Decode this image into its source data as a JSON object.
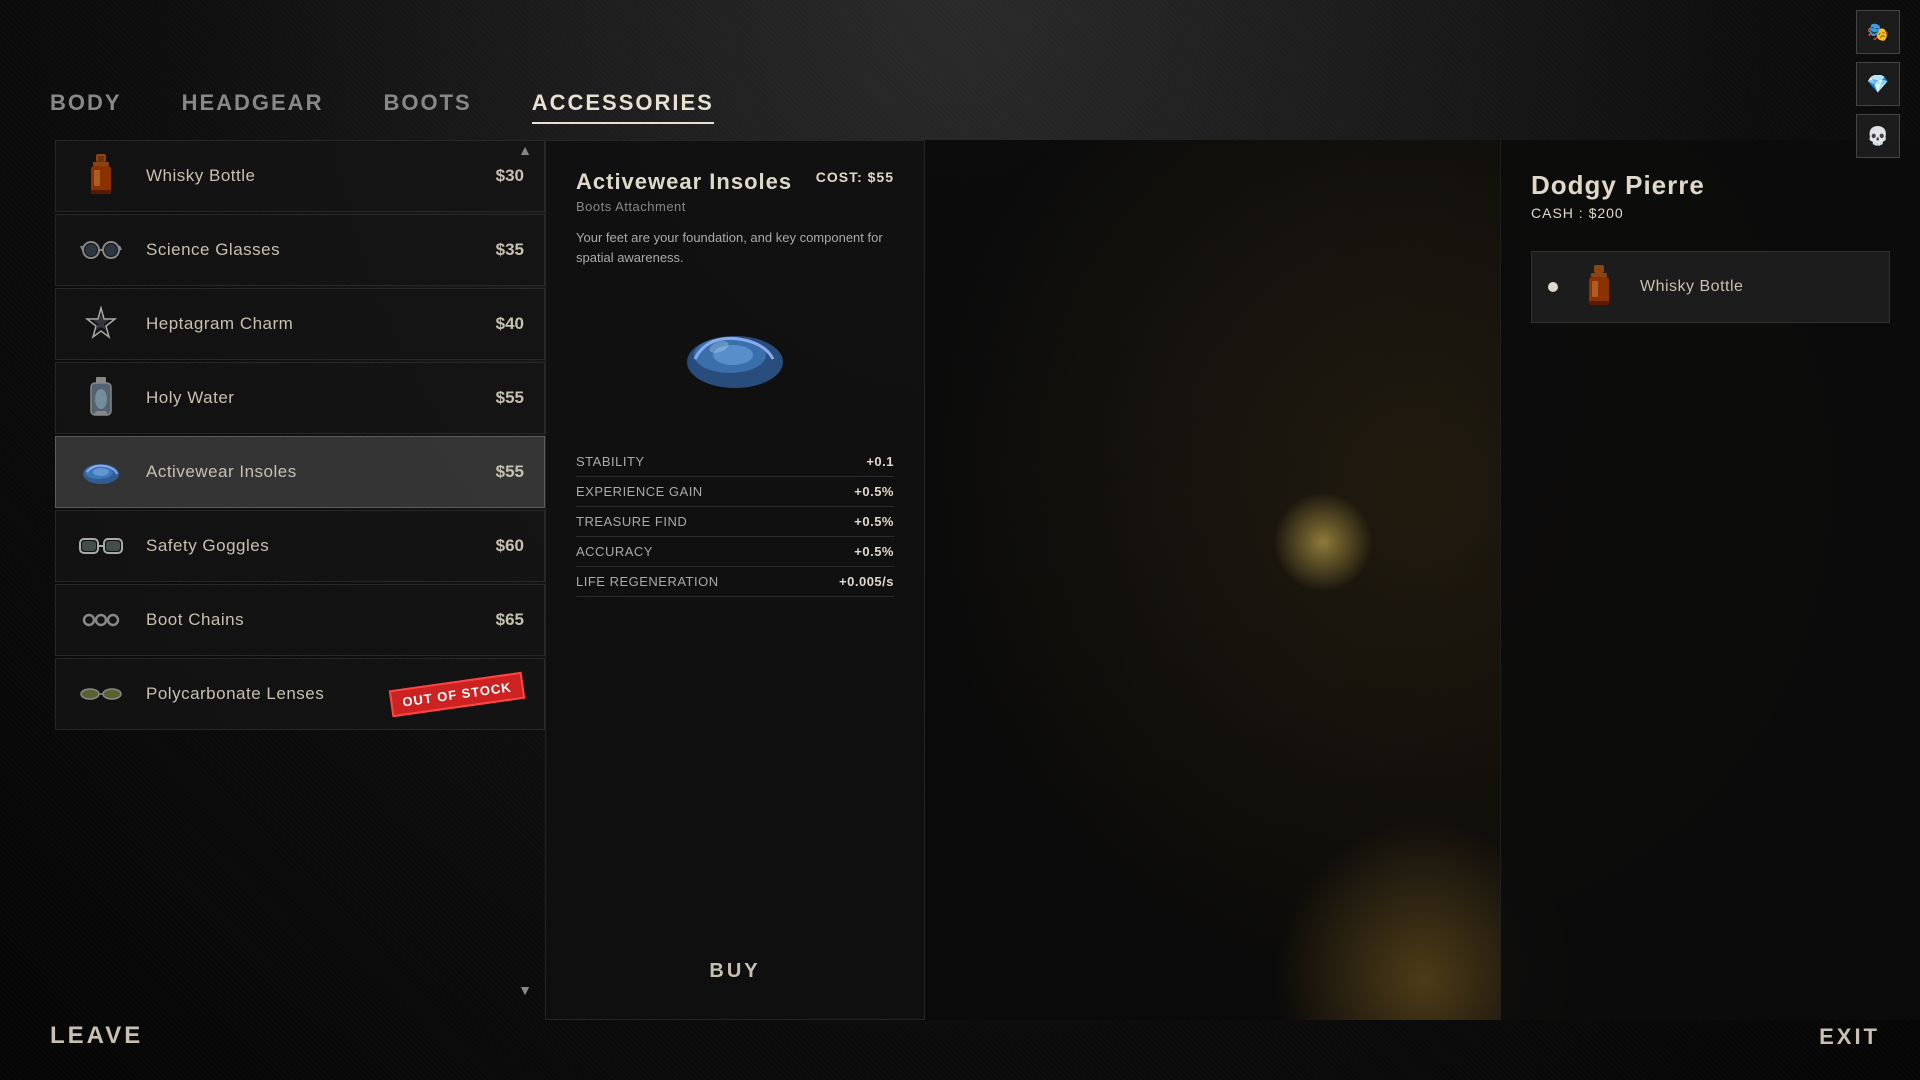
{
  "nav": {
    "tabs": [
      {
        "id": "body",
        "label": "BODY",
        "active": false
      },
      {
        "id": "headgear",
        "label": "HEADGEAR",
        "active": false
      },
      {
        "id": "boots",
        "label": "BOOTS",
        "active": false
      },
      {
        "id": "accessories",
        "label": "ACCESSORIES",
        "active": true
      }
    ]
  },
  "top_icons": [
    {
      "id": "icon1",
      "symbol": "🎭"
    },
    {
      "id": "icon2",
      "symbol": "💎"
    },
    {
      "id": "icon3",
      "symbol": "💀"
    }
  ],
  "items": [
    {
      "id": "whisky-bottle",
      "name": "Whisky Bottle",
      "price": "$30",
      "icon": "🍾",
      "out_of_stock": false
    },
    {
      "id": "science-glasses",
      "name": "Science Glasses",
      "price": "$35",
      "icon": "🥽",
      "out_of_stock": false
    },
    {
      "id": "heptagram-charm",
      "name": "Heptagram Charm",
      "price": "$40",
      "icon": "✴",
      "out_of_stock": false
    },
    {
      "id": "holy-water",
      "name": "Holy Water",
      "price": "$55",
      "icon": "🧪",
      "out_of_stock": false
    },
    {
      "id": "activewear-insoles",
      "name": "Activewear Insoles",
      "price": "$55",
      "icon": "👟",
      "out_of_stock": false,
      "active": true
    },
    {
      "id": "safety-goggles",
      "name": "Safety Goggles",
      "price": "$60",
      "icon": "🥽",
      "out_of_stock": false
    },
    {
      "id": "boot-chains",
      "name": "Boot Chains",
      "price": "$65",
      "icon": "⛓",
      "out_of_stock": false
    },
    {
      "id": "polycarbonate-lenses",
      "name": "Polycarbonate Lenses",
      "price": "",
      "icon": "🕶",
      "out_of_stock": true,
      "out_of_stock_label": "OUT OF STOCK"
    }
  ],
  "detail": {
    "title": "Activewear Insoles",
    "cost_label": "COST:",
    "cost_value": "$55",
    "subtitle": "Boots Attachment",
    "description": "Your feet are your foundation, and key component for spatial awareness.",
    "icon": "🩴",
    "stats": [
      {
        "name": "STABILITY",
        "value": "+0.1"
      },
      {
        "name": "EXPERIENCE GAIN",
        "value": "+0.5%"
      },
      {
        "name": "TREASURE FIND",
        "value": "+0.5%"
      },
      {
        "name": "ACCURACY",
        "value": "+0.5%"
      },
      {
        "name": "LIFE REGENERATION",
        "value": "+0.005/s"
      }
    ],
    "buy_label": "BUY"
  },
  "character": {
    "name": "Dodgy Pierre",
    "cash_label": "CASH :",
    "cash_value": "$200",
    "equipped_item": {
      "name": "Whisky Bottle",
      "icon": "🍾"
    }
  },
  "bottom": {
    "leave_label": "LEAVE",
    "exit_label": "EXIT"
  }
}
